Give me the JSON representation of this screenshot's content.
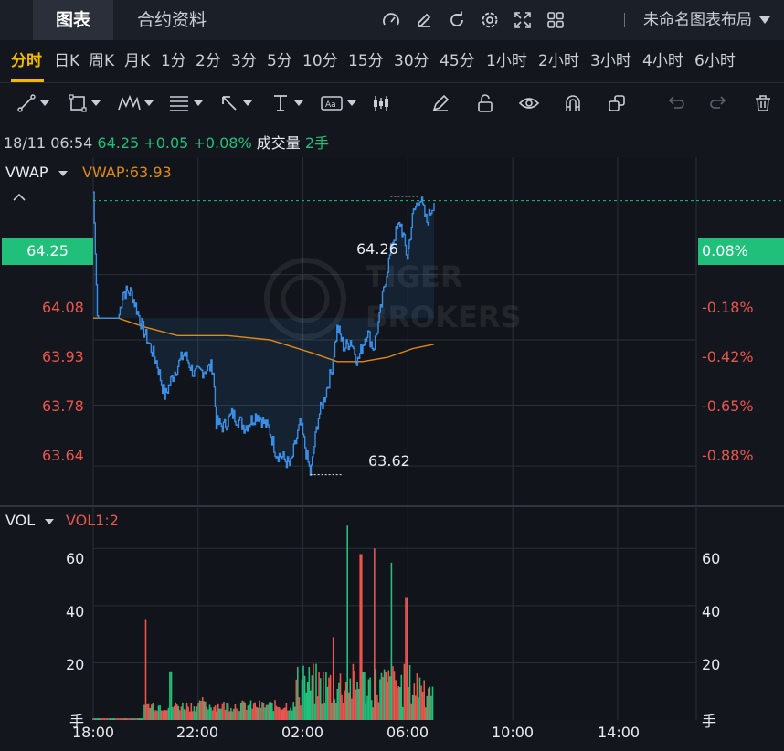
{
  "tabs": {
    "chart": "图表",
    "contract": "合约资料"
  },
  "layout_menu": "未命名图表布局",
  "intervals": [
    "分时",
    "日K",
    "周K",
    "月K",
    "1分",
    "2分",
    "3分",
    "5分",
    "10分",
    "15分",
    "30分",
    "45分",
    "1小时",
    "2小时",
    "3小时",
    "4小时",
    "6小时"
  ],
  "active_interval": "分时",
  "quote": {
    "time": "18/11 06:54",
    "price": "64.25",
    "change": "+0.05",
    "change_pct": "+0.08%",
    "volume_label": "成交量",
    "volume": "2手"
  },
  "vwap": {
    "name": "VWAP",
    "value_text": "VWAP:63.93"
  },
  "vol": {
    "name": "VOL",
    "value_text": "VOL1:2"
  },
  "price_axis": {
    "current": "64.25",
    "levels": [
      "64.08",
      "63.93",
      "63.78",
      "63.64"
    ]
  },
  "pct_axis": {
    "current": "0.08%",
    "levels": [
      "-0.18%",
      "-0.42%",
      "-0.65%",
      "-0.88%"
    ]
  },
  "annotations": {
    "high": "64.26",
    "low": "63.62"
  },
  "vol_axis": {
    "left": [
      "60",
      "40",
      "20",
      "手"
    ],
    "right": [
      "60",
      "40",
      "20",
      "手"
    ]
  },
  "time_axis": [
    "18:00",
    "22:00",
    "02:00",
    "06:00",
    "10:00",
    "14:00"
  ],
  "watermark": "TIGER BROKERS",
  "colors": {
    "up": "#21c07a",
    "down": "#e8564f",
    "line": "#3a8ee6",
    "vwap": "#e08a12",
    "accent": "#f5b800"
  },
  "chart_data": {
    "type": "line",
    "x_range": [
      "18:00",
      "17:00"
    ],
    "price_ylim": [
      63.55,
      64.35
    ],
    "price_series_knots": [
      [
        0,
        64.27
      ],
      [
        0.5,
        63.98
      ],
      [
        2.0,
        63.98
      ],
      [
        3.0,
        63.98
      ],
      [
        3.5,
        64.04
      ],
      [
        4.5,
        64.04
      ],
      [
        5.5,
        63.98
      ],
      [
        6.0,
        63.95
      ],
      [
        7.5,
        63.88
      ],
      [
        8.5,
        63.8
      ],
      [
        9.5,
        63.85
      ],
      [
        10.8,
        63.9
      ],
      [
        12.0,
        63.85
      ],
      [
        14.2,
        63.87
      ],
      [
        14.6,
        63.74
      ],
      [
        15.5,
        63.73
      ],
      [
        16.5,
        63.76
      ],
      [
        18.0,
        63.73
      ],
      [
        19.5,
        63.76
      ],
      [
        21.0,
        63.72
      ],
      [
        21.7,
        63.67
      ],
      [
        22.5,
        63.66
      ],
      [
        23.4,
        63.64
      ],
      [
        24.0,
        63.69
      ],
      [
        24.6,
        63.74
      ],
      [
        25.2,
        63.68
      ],
      [
        25.8,
        63.62
      ],
      [
        26.7,
        63.75
      ],
      [
        27.5,
        63.8
      ],
      [
        28.3,
        63.86
      ],
      [
        29.0,
        63.96
      ],
      [
        29.8,
        63.91
      ],
      [
        30.6,
        63.93
      ],
      [
        31.4,
        63.88
      ],
      [
        32.5,
        63.95
      ],
      [
        33.3,
        63.91
      ],
      [
        34.0,
        63.98
      ],
      [
        34.8,
        64.08
      ],
      [
        35.6,
        64.16
      ],
      [
        36.5,
        64.2
      ],
      [
        37.3,
        64.12
      ],
      [
        38.0,
        64.22
      ],
      [
        38.8,
        64.26
      ],
      [
        39.6,
        64.2
      ],
      [
        40.5,
        64.25
      ]
    ],
    "vwap_series_knots": [
      [
        0,
        63.98
      ],
      [
        3.0,
        63.98
      ],
      [
        6.0,
        63.96
      ],
      [
        10.0,
        63.94
      ],
      [
        16.0,
        63.94
      ],
      [
        21.0,
        63.93
      ],
      [
        26.0,
        63.9
      ],
      [
        29.0,
        63.88
      ],
      [
        32.0,
        63.88
      ],
      [
        35.0,
        63.89
      ],
      [
        38.0,
        63.91
      ],
      [
        40.5,
        63.92
      ]
    ],
    "vol_ylim": [
      0,
      70
    ],
    "volume_peaks": [
      [
        6.2,
        35
      ],
      [
        9.2,
        17
      ],
      [
        13.0,
        8
      ],
      [
        25.0,
        19
      ],
      [
        28.5,
        29
      ],
      [
        30.2,
        68
      ],
      [
        31.8,
        58
      ],
      [
        33.4,
        60
      ],
      [
        35.5,
        55
      ],
      [
        37.2,
        43
      ],
      [
        39.0,
        12
      ]
    ]
  }
}
